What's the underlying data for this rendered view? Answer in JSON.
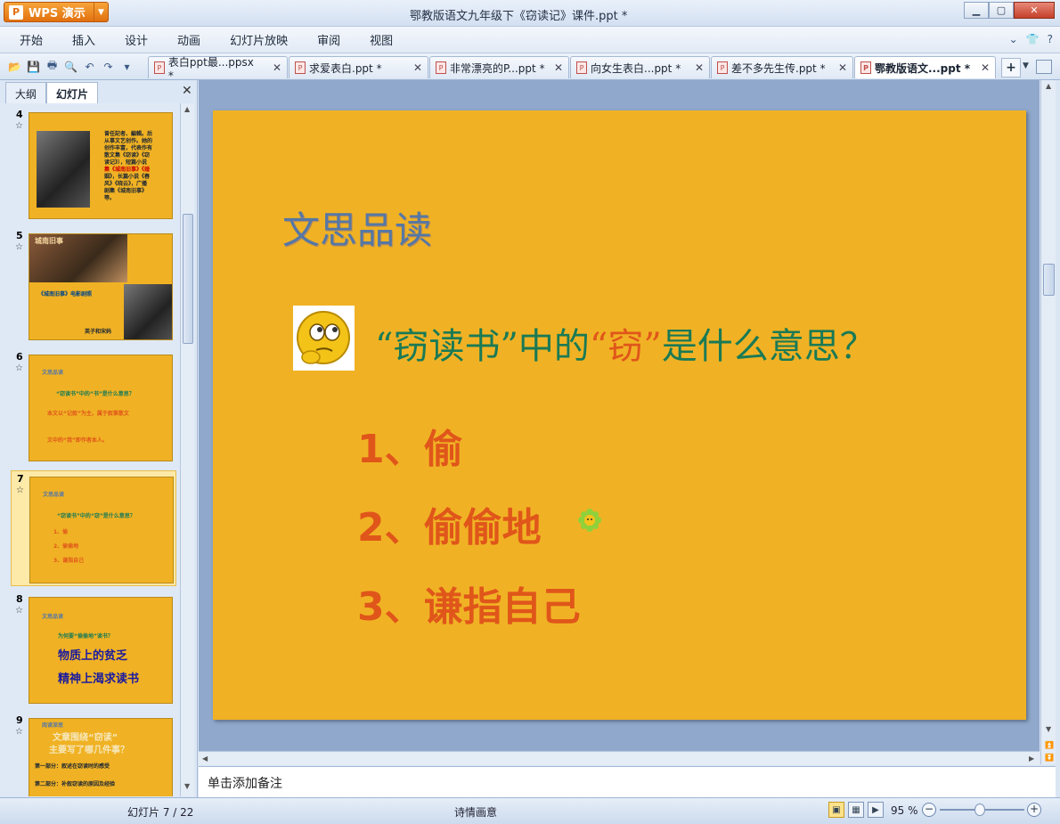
{
  "app": {
    "name": "WPS 演示",
    "window_title": "鄂教版语文九年级下《窃读记》课件.ppt *"
  },
  "menu": [
    "开始",
    "插入",
    "设计",
    "动画",
    "幻灯片放映",
    "审阅",
    "视图"
  ],
  "doc_tabs": [
    {
      "label": "表白ppt最...ppsx *"
    },
    {
      "label": "求爱表白.ppt *"
    },
    {
      "label": "非常漂亮的P...ppt *"
    },
    {
      "label": "向女生表白...ppt *"
    },
    {
      "label": "差不多先生传.ppt *"
    },
    {
      "label": "鄂教版语文...ppt *",
      "active": true
    }
  ],
  "panel": {
    "tabs": [
      "大纲",
      "幻灯片"
    ],
    "active_tab": "幻灯片"
  },
  "thumbnails": [
    {
      "num": "4",
      "lines": [
        "曾任記者、編輯。后",
        "从事文艺创作。她的",
        "创作丰富，代表作有",
        "散文集《窃读》《窃",
        "读记》），短篇小说",
        "集《城南旧事》《婚",
        "姻》，长篇小说《春",
        "风》《晓云》，广播",
        "剧集《城南旧事》",
        "等。"
      ]
    },
    {
      "num": "5",
      "lines": [
        "城南旧事",
        "《城南旧事》电影剧照",
        "英子和宋妈"
      ]
    },
    {
      "num": "6",
      "lines": [
        "文思品读",
        "“窃读书”中的“书”是什么意思？",
        "本文以“记叙”为主，属于叙事散文",
        "文中的“我”即作者本人。"
      ]
    },
    {
      "num": "7",
      "selected": true,
      "lines": [
        "文思品读",
        "“窃读书”中的“窃”是什么意思？",
        "1、偷",
        "2、偷偷地",
        "3、谦指自己"
      ]
    },
    {
      "num": "8",
      "lines": [
        "文思品读",
        "为何要“偷偷地”读书？",
        "物质上的贫乏",
        "精神上渴求读书"
      ]
    },
    {
      "num": "9",
      "lines": [
        "阅读深思",
        "文章围绕“窃读”",
        "主要写了哪几件事？",
        "第一部分：叙述在窃读时的感受",
        "第二部分：补叙窃读的原因及经验"
      ]
    }
  ],
  "slide": {
    "title": "文思品读",
    "question_parts": [
      "“窃读书”中的",
      "“窃”",
      "是什么意思？"
    ],
    "items": [
      "1、偷",
      "2、偷偷地",
      "3、谦指自己"
    ],
    "colors": {
      "background": "#f0b224",
      "title": "#5677a5",
      "question": "#1a7a55",
      "highlight": "#e0561a",
      "items": "#e0561a"
    }
  },
  "notes": {
    "placeholder": "单击添加备注"
  },
  "status": {
    "slide_indicator": "幻灯片 7 / 22",
    "theme": "诗情画意",
    "zoom": "95 %"
  }
}
